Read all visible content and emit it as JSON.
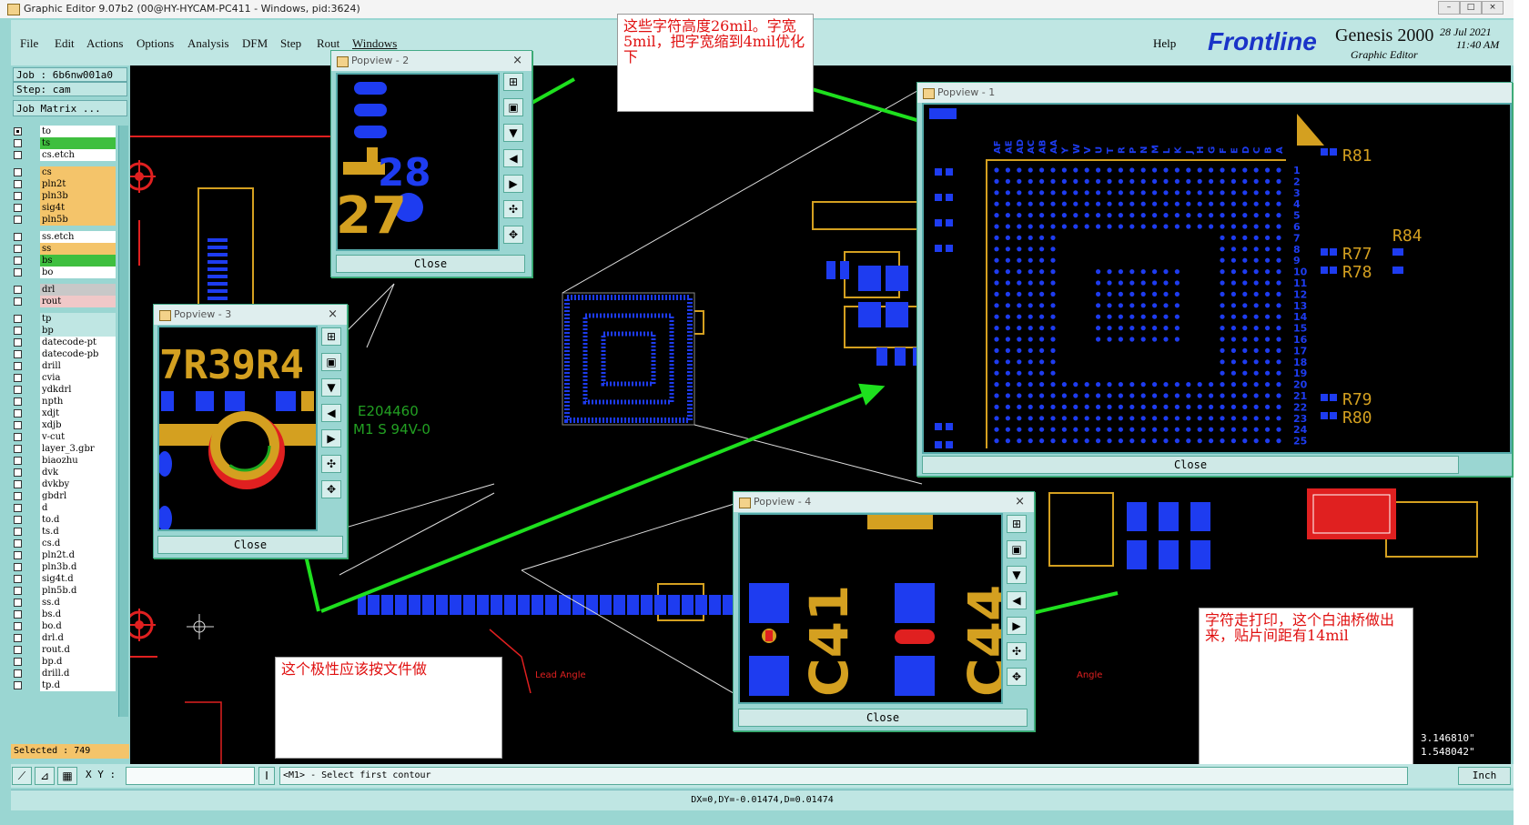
{
  "window": {
    "title": "Graphic Editor 9.07b2 (00@HY-HYCAM-PC411 - Windows, pid:3624)"
  },
  "menubar": {
    "items": [
      "File",
      "Edit",
      "Actions",
      "Options",
      "Analysis",
      "DFM",
      "Step",
      "Rout",
      "Windows"
    ],
    "help": "Help"
  },
  "brand": {
    "logo": "Frontline",
    "product": "Genesis 2000",
    "subtitle": "Graphic Editor",
    "date": "28 Jul 2021",
    "time": "11:40 AM"
  },
  "job_panel": {
    "job": "Job : 6b6nw001a0",
    "step": "Step: cam",
    "matrix_button": "Job Matrix ..."
  },
  "layers": [
    {
      "name": "to",
      "color": "#ffffff",
      "checked": true,
      "mark": "↗"
    },
    {
      "name": "ts",
      "color": "#3fbf3f",
      "checked": false,
      "mark": "↗"
    },
    {
      "name": "cs.etch",
      "color": "#ffffff",
      "checked": false,
      "mark": ""
    },
    {
      "name": "cs",
      "color": "#f4c46a",
      "checked": false,
      "mark": "↗"
    },
    {
      "name": "pln2t",
      "color": "#f4c46a",
      "checked": false,
      "mark": "↗"
    },
    {
      "name": "pln3b",
      "color": "#f4c46a",
      "checked": false,
      "mark": "↗"
    },
    {
      "name": "sig4t",
      "color": "#f4c46a",
      "checked": false,
      "mark": "↗"
    },
    {
      "name": "pln5b",
      "color": "#f4c46a",
      "checked": false,
      "mark": "↗"
    },
    {
      "name": "ss.etch",
      "color": "#ffffff",
      "checked": false,
      "mark": ""
    },
    {
      "name": "ss",
      "color": "#f4c46a",
      "checked": false,
      "mark": "↗"
    },
    {
      "name": "bs",
      "color": "#3fbf3f",
      "checked": false,
      "mark": "↗"
    },
    {
      "name": "bo",
      "color": "#ffffff",
      "checked": false,
      "mark": "↗"
    },
    {
      "name": "drl",
      "color": "#c8c8c8",
      "checked": false,
      "mark": ""
    },
    {
      "name": "rout",
      "color": "#f0c8c8",
      "checked": false,
      "mark": ""
    },
    {
      "name": "tp",
      "color": "#bfe6e3",
      "checked": false,
      "mark": "↗"
    },
    {
      "name": "bp",
      "color": "#bfe6e3",
      "checked": false,
      "mark": "↗"
    },
    {
      "name": "datecode-pt",
      "color": "#ffffff",
      "checked": false,
      "mark": ""
    },
    {
      "name": "datecode-pb",
      "color": "#ffffff",
      "checked": false,
      "mark": ""
    },
    {
      "name": "drill",
      "color": "#ffffff",
      "checked": false,
      "mark": "↗"
    },
    {
      "name": "cvia",
      "color": "#ffffff",
      "checked": false,
      "mark": ""
    },
    {
      "name": "ydkdrl",
      "color": "#ffffff",
      "checked": false,
      "mark": ""
    },
    {
      "name": "npth",
      "color": "#ffffff",
      "checked": false,
      "mark": ""
    },
    {
      "name": "xdjt",
      "color": "#ffffff",
      "checked": false,
      "mark": ""
    },
    {
      "name": "xdjb",
      "color": "#ffffff",
      "checked": false,
      "mark": ""
    },
    {
      "name": "v-cut",
      "color": "#ffffff",
      "checked": false,
      "mark": ""
    },
    {
      "name": "layer_3.gbr",
      "color": "#ffffff",
      "checked": false,
      "mark": ""
    },
    {
      "name": "biaozhu",
      "color": "#ffffff",
      "checked": false,
      "mark": ""
    },
    {
      "name": "dvk",
      "color": "#ffffff",
      "checked": false,
      "mark": ""
    },
    {
      "name": "dvkby",
      "color": "#ffffff",
      "checked": false,
      "mark": ""
    },
    {
      "name": "gbdrl",
      "color": "#ffffff",
      "checked": false,
      "mark": ""
    },
    {
      "name": "d",
      "color": "#ffffff",
      "checked": false,
      "mark": ""
    },
    {
      "name": "to.d",
      "color": "#ffffff",
      "checked": false,
      "mark": "↗"
    },
    {
      "name": "ts.d",
      "color": "#ffffff",
      "checked": false,
      "mark": "↗"
    },
    {
      "name": "cs.d",
      "color": "#ffffff",
      "checked": false,
      "mark": "↗"
    },
    {
      "name": "pln2t.d",
      "color": "#ffffff",
      "checked": false,
      "mark": "↗"
    },
    {
      "name": "pln3b.d",
      "color": "#ffffff",
      "checked": false,
      "mark": "↗"
    },
    {
      "name": "sig4t.d",
      "color": "#ffffff",
      "checked": false,
      "mark": "↗"
    },
    {
      "name": "pln5b.d",
      "color": "#ffffff",
      "checked": false,
      "mark": "↗"
    },
    {
      "name": "ss.d",
      "color": "#ffffff",
      "checked": false,
      "mark": "↗"
    },
    {
      "name": "bs.d",
      "color": "#ffffff",
      "checked": false,
      "mark": "↗"
    },
    {
      "name": "bo.d",
      "color": "#ffffff",
      "checked": false,
      "mark": "↗"
    },
    {
      "name": "drl.d",
      "color": "#ffffff",
      "checked": false,
      "mark": "↗"
    },
    {
      "name": "rout.d",
      "color": "#ffffff",
      "checked": false,
      "mark": "↗"
    },
    {
      "name": "bp.d",
      "color": "#ffffff",
      "checked": false,
      "mark": "↗"
    },
    {
      "name": "drill.d",
      "color": "#ffffff",
      "checked": false,
      "mark": "↗"
    },
    {
      "name": "tp.d",
      "color": "#ffffff",
      "checked": false,
      "mark": "↗"
    }
  ],
  "selected": "Selected : 749",
  "bottom": {
    "xy_label": "X Y :",
    "xy_value": "",
    "prompt": "<M1> - Select first contour",
    "coord_x": "3.146810\"",
    "coord_y": "1.548042\"",
    "units": "Inch",
    "status": "DX=0,DY=-0.01474,D=0.01474"
  },
  "popups": [
    {
      "title": "Popview - 2",
      "close": "Close"
    },
    {
      "title": "Popview - 3",
      "close": "Close"
    },
    {
      "title": "Popview - 1",
      "close": "Close"
    },
    {
      "title": "Popview - 4",
      "close": "Close"
    }
  ],
  "popup_content": {
    "p2": [
      "28",
      "27"
    ],
    "p3": [
      "7R39R4"
    ],
    "p1_refs": [
      "R81",
      "R77",
      "R78",
      "R84",
      "R79",
      "R80"
    ],
    "p1_top_labels": [
      "AF",
      "AE",
      "AD",
      "AC",
      "AB",
      "AA",
      "Y",
      "W",
      "V",
      "U",
      "T",
      "R",
      "P",
      "N",
      "M",
      "L",
      "K",
      "J",
      "H",
      "G",
      "F",
      "E",
      "D",
      "C",
      "B",
      "A"
    ],
    "p1_side_numbers": [
      "1",
      "2",
      "3",
      "4",
      "5",
      "6",
      "7",
      "8",
      "9",
      "10",
      "11",
      "12",
      "13",
      "14",
      "15",
      "16",
      "17",
      "18",
      "19",
      "20",
      "21",
      "22",
      "23",
      "24",
      "25"
    ],
    "p4": [
      "C41",
      "C44"
    ]
  },
  "canvas_text": {
    "silk1": "E204460",
    "silk2": "M1 S 94V-0",
    "lead_angle": "Lead Angle",
    "angle": "Angle"
  },
  "notes": {
    "n1": "这些字符高度26mil。字宽5mil，把字宽缩到4mil优化下",
    "n2": "这个极性应该按文件做",
    "n3": "字符走打印，这个白油桥做出来，贴片间距有14mil"
  },
  "colors": {
    "copper": "#d4a020",
    "pad": "#1e3cf0",
    "board_edge": "#e02020",
    "arrow": "#1ee01e",
    "note_text": "#e01010"
  }
}
